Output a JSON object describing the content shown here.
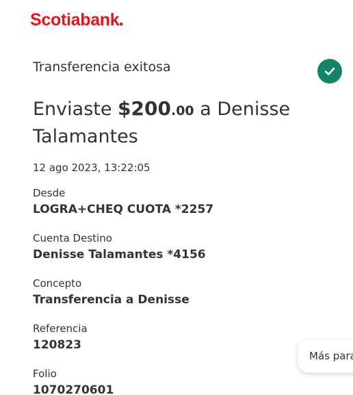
{
  "brand": {
    "logo_text": "Scotiabank",
    "color": "#ec111a"
  },
  "status": {
    "text": "Transferencia exitosa",
    "icon": "check-circle-icon",
    "icon_color": "#138468"
  },
  "headline": {
    "prefix": "Enviaste ",
    "amount_main": "$200",
    "amount_cents": ".00",
    "suffix": " a Denisse Talamantes"
  },
  "datetime": "12 ago 2023, 13:22:05",
  "fields": [
    {
      "label": "Desde",
      "value": "LOGRA+CHEQ CUOTA *2257"
    },
    {
      "label": "Cuenta Destino",
      "value": "Denisse Talamantes *4156"
    },
    {
      "label": "Concepto",
      "value": "Transferencia a Denisse"
    },
    {
      "label": "Referencia",
      "value": "120823"
    },
    {
      "label": "Folio",
      "value": "1070270601"
    }
  ],
  "more_button": {
    "label": "Más para"
  }
}
